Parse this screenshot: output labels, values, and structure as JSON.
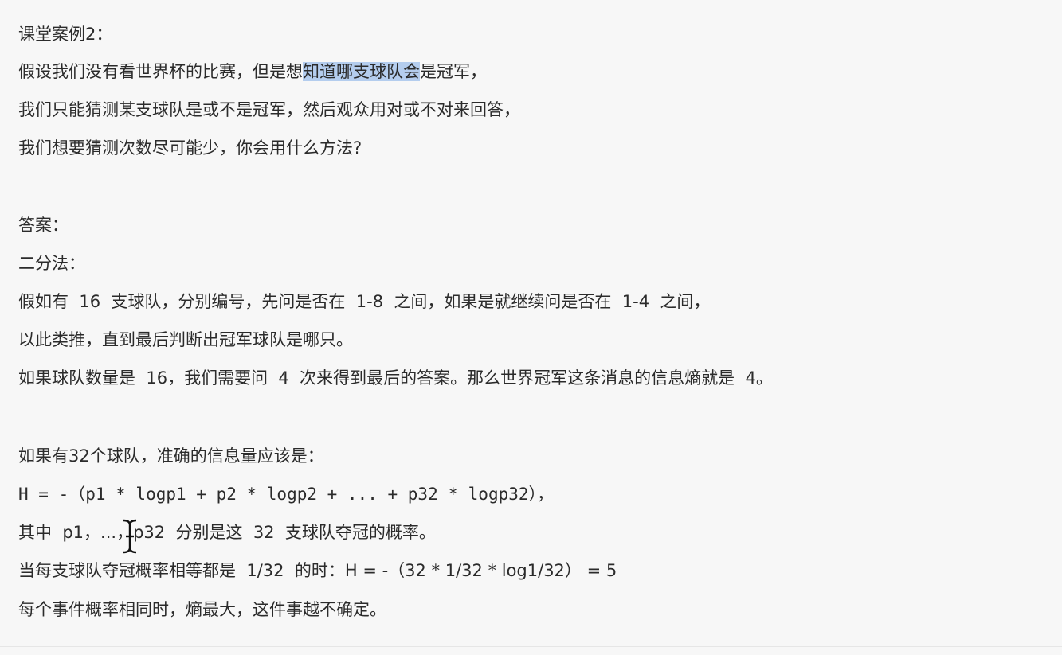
{
  "document": {
    "case_title": "课堂案例2：",
    "question": {
      "line1_before": "假设我们没有看世界杯的比赛，但是想",
      "line1_highlight": "知道哪支球队会",
      "line1_after": "是冠军，",
      "line2": "我们只能猜测某支球队是或不是冠军，然后观众用对或不对来回答，",
      "line3": "我们想要猜测次数尽可能少，你会用什么方法?"
    },
    "answer_label": "答案：",
    "method_label": "二分法：",
    "method_lines": [
      "假如有  16  支球队，分别编号，先问是否在  1-8  之间，如果是就继续问是否在  1-4  之间，",
      "以此类推，直到最后判断出冠军球队是哪只。",
      "如果球队数量是  16，我们需要问  4  次来得到最后的答案。那么世界冠军这条消息的信息熵就是  4。"
    ],
    "entropy_intro": "如果有32个球队，准确的信息量应该是：",
    "formula": "H = -（p1 * logp1 + p2 * logp2 + ... + p32 * logp32），",
    "formula_note": "其中  p1，...，p32  分别是这  32  支球队夺冠的概率。",
    "equal_prob": "当每支球队夺冠概率相等都是  1/32  的时：H = -（32 * 1/32 * log1/32） = 5",
    "conclusion": "每个事件概率相同时，熵最大，这件事越不确定。"
  },
  "icons": {
    "cursor": "text-cursor-icon"
  },
  "colors": {
    "highlight": "#b4cdee",
    "text": "#2b2b2b",
    "background": "#f7f7f7"
  }
}
